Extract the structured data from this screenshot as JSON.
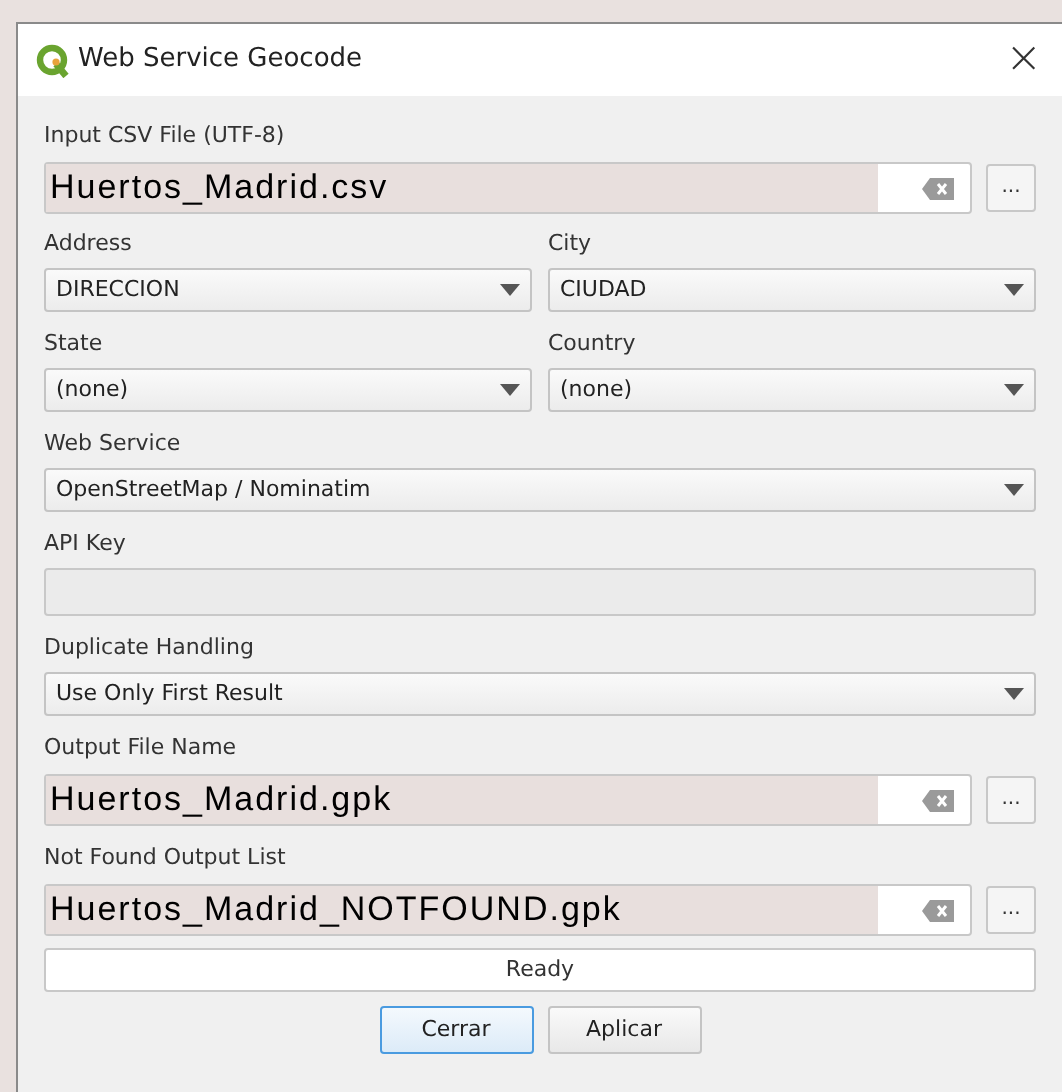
{
  "window": {
    "title": "Web Service Geocode",
    "close": "×"
  },
  "input_file": {
    "label": "Input CSV File (UTF-8)",
    "value": "Huertos_Madrid.csv",
    "browse": "..."
  },
  "address": {
    "label": "Address",
    "value": "DIRECCION"
  },
  "city": {
    "label": "City",
    "value": "CIUDAD"
  },
  "state": {
    "label": "State",
    "value": "(none)"
  },
  "country": {
    "label": "Country",
    "value": "(none)"
  },
  "web_service": {
    "label": "Web Service",
    "value": "OpenStreetMap / Nominatim"
  },
  "api_key": {
    "label": "API Key"
  },
  "duplicate_handling": {
    "label": "Duplicate Handling",
    "value": "Use Only First Result"
  },
  "output_file": {
    "label": "Output File Name",
    "value": "Huertos_Madrid.gpk",
    "browse": "..."
  },
  "not_found_file": {
    "label": "Not Found Output List",
    "value": "Huertos_Madrid_NOTFOUND.gpk",
    "browse": "..."
  },
  "progress": {
    "text": "Ready"
  },
  "buttons": [
    {
      "label": "Cerrar",
      "default": true
    },
    {
      "label": "Aplicar",
      "default": false
    }
  ]
}
